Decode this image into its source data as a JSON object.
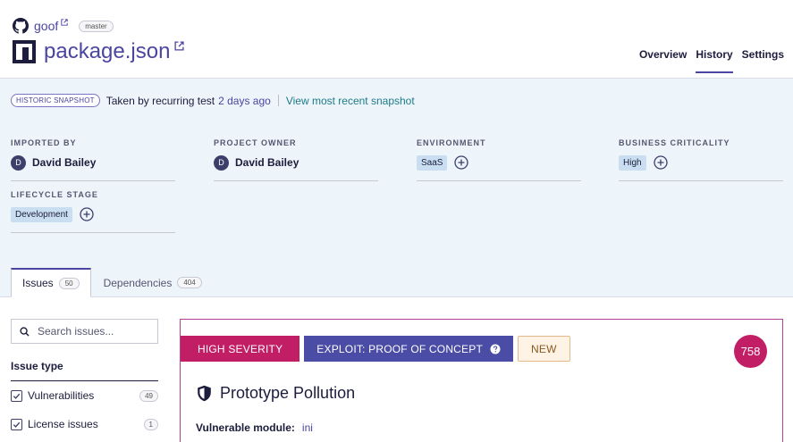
{
  "header": {
    "repo_name": "goof",
    "branch": "master",
    "title": "package.json",
    "tabs": [
      {
        "label": "Overview",
        "active": false
      },
      {
        "label": "History",
        "active": true
      },
      {
        "label": "Settings",
        "active": false
      }
    ]
  },
  "snapshot": {
    "badge": "HISTORIC SNAPSHOT",
    "taken_by": "Taken by recurring test",
    "time": "2 days ago",
    "link": "View most recent snapshot"
  },
  "meta": {
    "imported_by": {
      "label": "IMPORTED BY",
      "initial": "D",
      "name": "David Bailey"
    },
    "project_owner": {
      "label": "PROJECT OWNER",
      "initial": "D",
      "name": "David Bailey"
    },
    "environment": {
      "label": "ENVIRONMENT",
      "value": "SaaS"
    },
    "business_criticality": {
      "label": "BUSINESS CRITICALITY",
      "value": "High"
    },
    "lifecycle_stage": {
      "label": "LIFECYCLE STAGE",
      "value": "Development"
    }
  },
  "issue_tabs": [
    {
      "label": "Issues",
      "count": "50",
      "active": true
    },
    {
      "label": "Dependencies",
      "count": "404",
      "active": false
    }
  ],
  "filters": {
    "search_placeholder": "Search issues...",
    "title": "Issue type",
    "items": [
      {
        "label": "Vulnerabilities",
        "count": "49",
        "checked": true
      },
      {
        "label": "License issues",
        "count": "1",
        "checked": true
      }
    ]
  },
  "issue": {
    "severity": "HIGH SEVERITY",
    "exploit": "EXPLOIT: PROOF OF CONCEPT",
    "new_label": "NEW",
    "score": "758",
    "title": "Prototype Pollution",
    "vulnerable_module_label": "Vulnerable module:",
    "vulnerable_module": "ini"
  },
  "colors": {
    "brand": "#4b45a1",
    "high_severity": "#c21e65",
    "exploit": "#4a4ca6",
    "snapshot_bg": "#eef5fa"
  }
}
